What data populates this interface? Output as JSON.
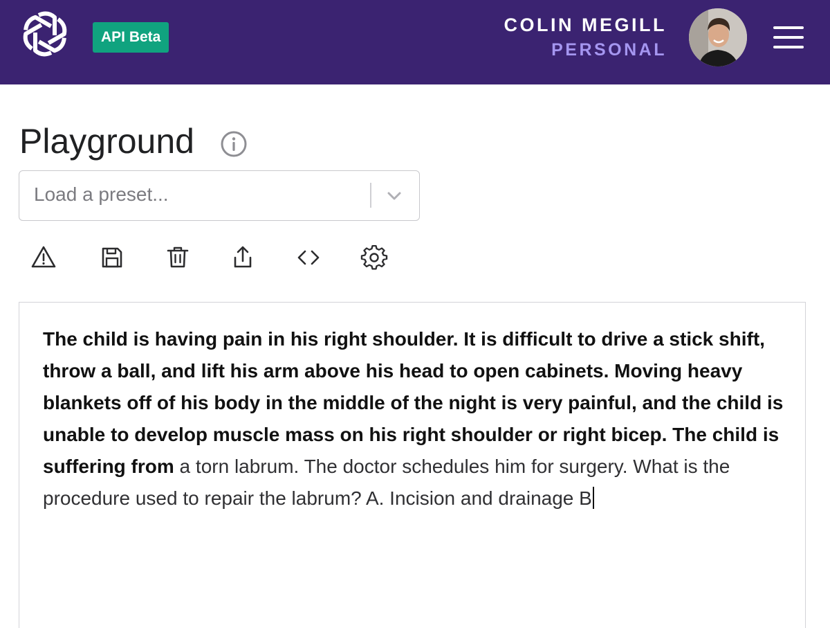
{
  "header": {
    "logo_icon": "openai-logo-icon",
    "badge_label": "API Beta",
    "user_name": "COLIN MEGILL",
    "org_name": "PERSONAL",
    "menu_icon": "hamburger-menu-icon",
    "colors": {
      "bar": "#3b2371",
      "badge": "#10a37f",
      "org_text": "#a596f0"
    }
  },
  "page": {
    "title": "Playground",
    "info_icon": "info-icon"
  },
  "preset": {
    "placeholder": "Load a preset...",
    "chevron_icon": "chevron-down-icon"
  },
  "toolbar": [
    {
      "icon": "warning-icon"
    },
    {
      "icon": "save-icon"
    },
    {
      "icon": "trash-icon"
    },
    {
      "icon": "share-icon"
    },
    {
      "icon": "code-icon"
    },
    {
      "icon": "settings-icon"
    }
  ],
  "editor": {
    "prompt": "The child is having pain in his right shoulder. It is difficult to drive a stick shift, throw a ball, and lift his arm above his head to open cabinets. Moving heavy blankets off of his body in the middle of the night is very painful, and the child is unable to develop muscle mass on his right shoulder or right bicep. The child is suffering from",
    "completion": " a torn labrum. The doctor schedules him for surgery. What is the procedure used to repair the labrum? A. Incision and drainage B"
  }
}
